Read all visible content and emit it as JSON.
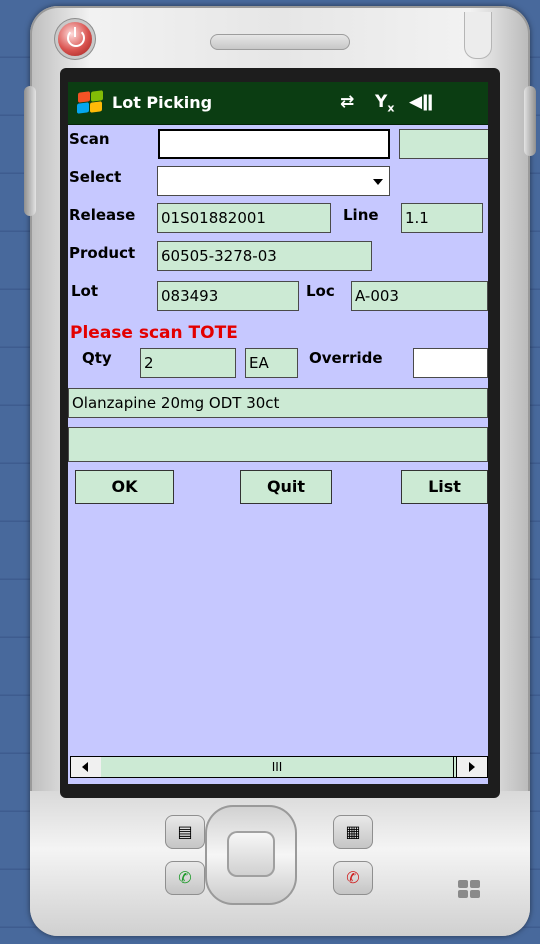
{
  "app": {
    "title": "Lot Picking",
    "status_icons": [
      "sync-icon",
      "signal-off-icon",
      "volume-muted-icon"
    ]
  },
  "form": {
    "scan": {
      "label": "Scan",
      "value": ""
    },
    "select": {
      "label": "Select",
      "value": ""
    },
    "release": {
      "label": "Release",
      "value": "01S01882001"
    },
    "line": {
      "label": "Line",
      "value": "1.1"
    },
    "product": {
      "label": "Product",
      "value": "60505-3278-03"
    },
    "lot": {
      "label": "Lot",
      "value": "083493"
    },
    "loc": {
      "label": "Loc",
      "value": "A-003"
    },
    "message": "Please scan TOTE",
    "qty": {
      "label": "Qty",
      "value": "2",
      "uom": "EA"
    },
    "override": {
      "label": "Override",
      "value": ""
    },
    "description": "Olanzapine 20mg ODT 30ct",
    "extra": ""
  },
  "buttons": {
    "ok": "OK",
    "quit": "Quit",
    "list": "List"
  },
  "scrollbar": {
    "thumb_label": "III"
  },
  "colors": {
    "screen_bg": "#c6c8ff",
    "field_bg": "#ccead4",
    "title_bar": "#0b3d12",
    "message": "#e30000"
  }
}
